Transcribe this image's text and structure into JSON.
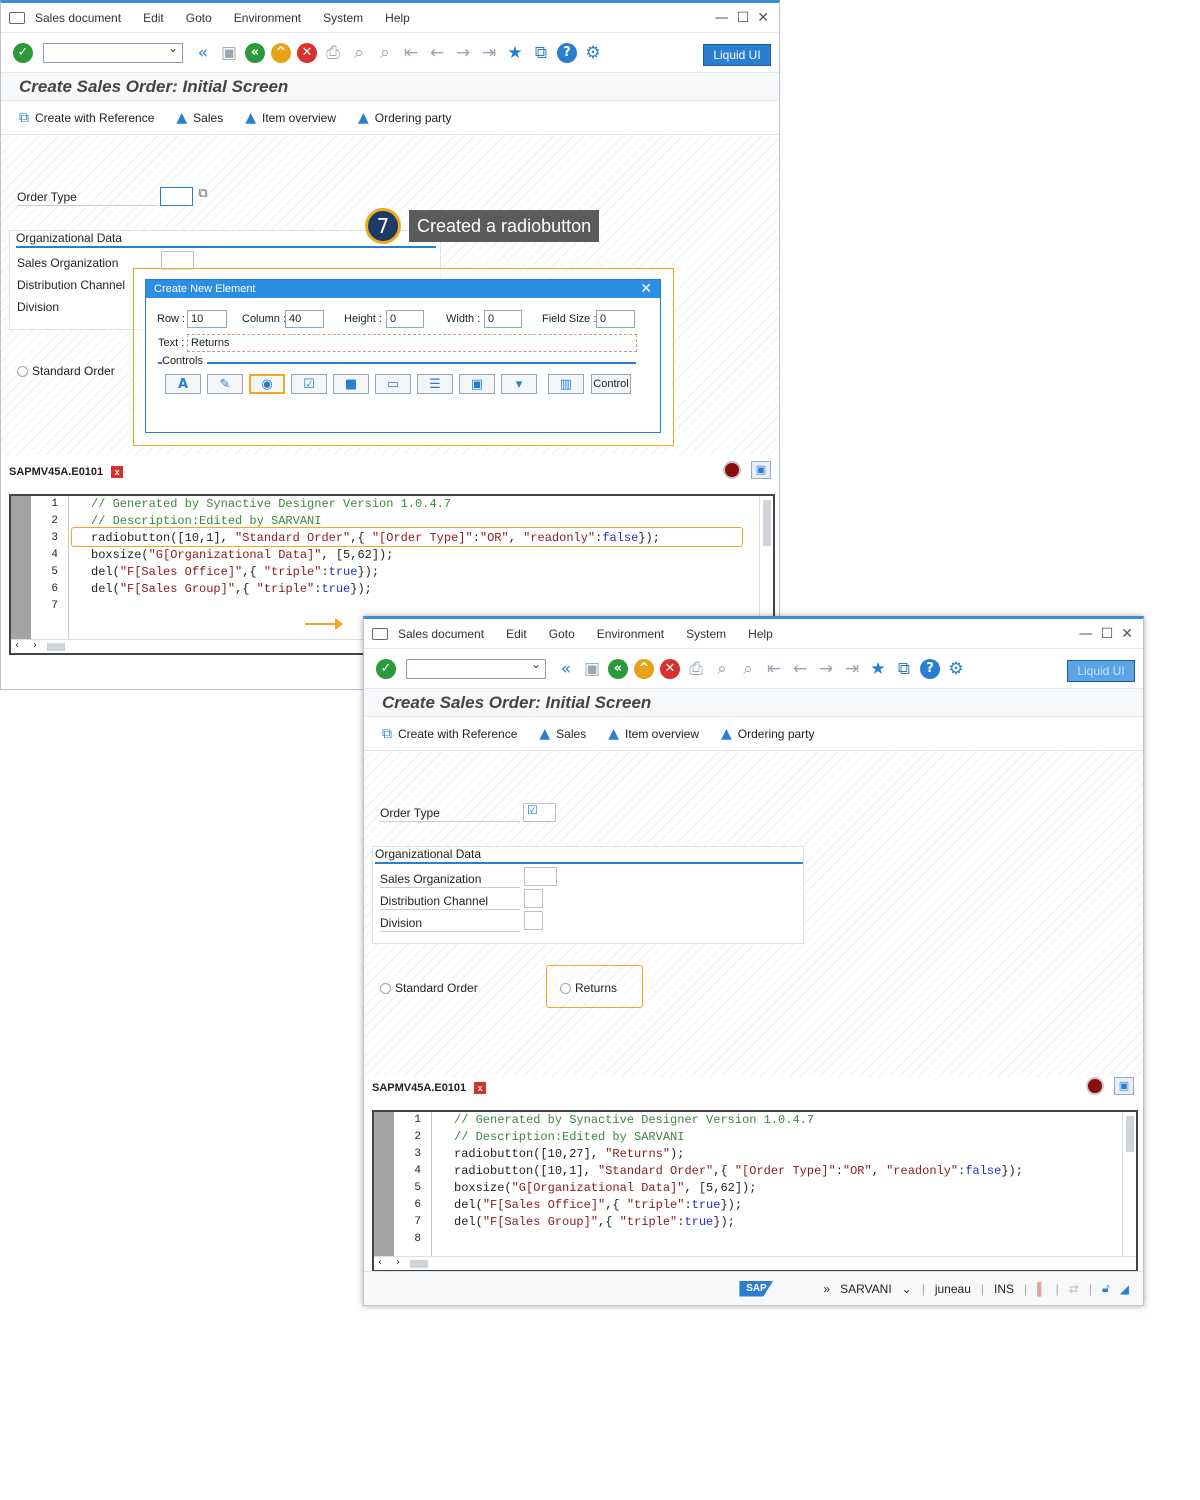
{
  "menu": [
    "Sales document",
    "Edit",
    "Goto",
    "Environment",
    "System",
    "Help"
  ],
  "liquid_ui_label": "Liquid UI",
  "screen_title": "Create Sales Order: Initial Screen",
  "app_toolbar": [
    "Create with Reference",
    "Sales",
    "Item overview",
    "Ordering party"
  ],
  "fields": {
    "order_type": "Order Type",
    "org_data": "Organizational Data",
    "sales_org": "Sales Organization",
    "dist_channel": "Distribution Channel",
    "division": "Division"
  },
  "radios": {
    "standard": "Standard Order",
    "returns": "Returns"
  },
  "editor_tab": "SAPMV45A.E0101",
  "callout": {
    "number": "7",
    "text": "Created a radiobutton"
  },
  "dialog": {
    "title": "Create New Element",
    "row_label": "Row :",
    "row_value": "10",
    "column_label": "Column :",
    "column_value": "40",
    "height_label": "Height :",
    "height_value": "0",
    "width_label": "Width :",
    "width_value": "0",
    "fieldsize_label": "Field Size :",
    "fieldsize_value": "0",
    "text_label": "Text :",
    "text_value": "Returns",
    "controls_label": "Controls",
    "control_button": "Control"
  },
  "code1": [
    "// Generated by Synactive Designer Version 1.0.4.7",
    "// Description:Edited by SARVANI",
    "radiobutton([10,1], \"Standard Order\",{ \"[Order Type]\":\"OR\", \"readonly\":false});",
    "boxsize(\"G[Organizational Data]\", [5,62]);",
    "del(\"F[Sales Office]\",{ \"triple\":true});",
    "del(\"F[Sales Group]\",{ \"triple\":true});",
    ""
  ],
  "code2": [
    "// Generated by Synactive Designer Version 1.0.4.7",
    "// Description:Edited by SARVANI",
    "radiobutton([10,27], \"Returns\");",
    "radiobutton([10,1], \"Standard Order\",{ \"[Order Type]\":\"OR\", \"readonly\":false});",
    "boxsize(\"G[Organizational Data]\", [5,62]);",
    "del(\"F[Sales Office]\",{ \"triple\":true});",
    "del(\"F[Sales Group]\",{ \"triple\":true});",
    ""
  ],
  "status": {
    "sap": "SAP",
    "user": "SARVANI",
    "server": "juneau",
    "mode": "INS"
  },
  "colors": {
    "accent": "#2a7ed2",
    "highlight": "#f0a81c",
    "callout_bg": "#1e3a66"
  }
}
